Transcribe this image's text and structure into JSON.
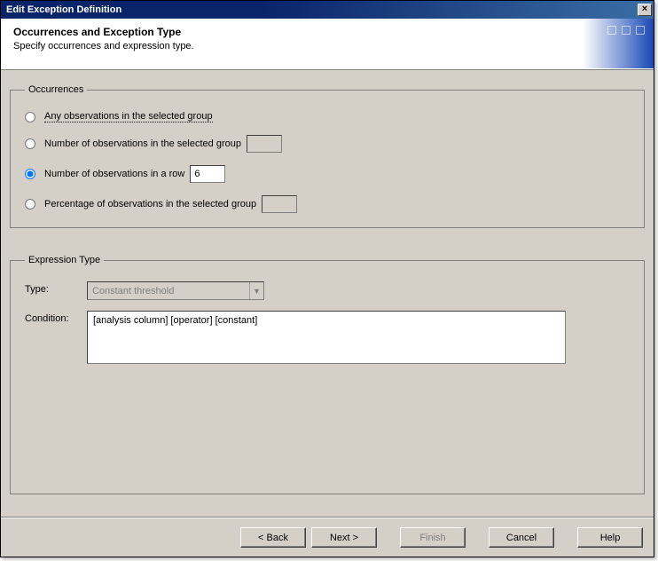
{
  "window": {
    "title": "Edit Exception Definition"
  },
  "header": {
    "title": "Occurrences and Exception Type",
    "subtitle": "Specify occurrences and expression type."
  },
  "occurrences": {
    "legend": "Occurrences",
    "opt_any": "Any observations in the selected group",
    "opt_num_group": "Number of observations in the selected group",
    "opt_num_row": "Number of observations in a row",
    "opt_pct_group": "Percentage of observations in the selected group",
    "num_row_value": "6",
    "num_group_value": "",
    "pct_group_value": ""
  },
  "expression": {
    "legend": "Expression Type",
    "type_label": "Type:",
    "type_value": "Constant threshold",
    "condition_label": "Condition:",
    "condition_value": "[analysis column] [operator] [constant]"
  },
  "buttons": {
    "back": "< Back",
    "next": "Next >",
    "finish": "Finish",
    "cancel": "Cancel",
    "help": "Help"
  }
}
